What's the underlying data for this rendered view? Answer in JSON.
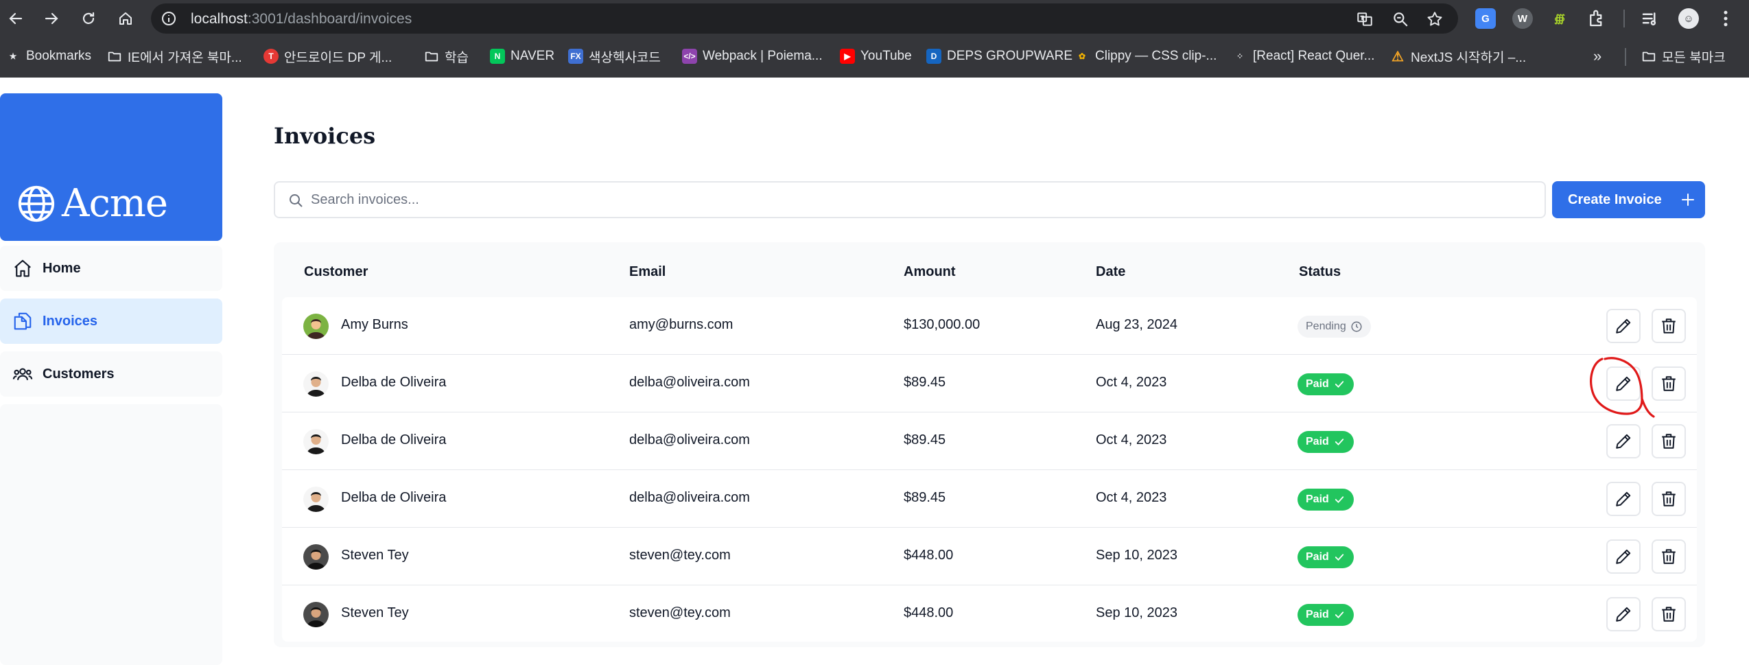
{
  "browser": {
    "url_host": "localhost",
    "url_rest": ":3001/dashboard/invoices",
    "bookmarks": [
      {
        "label": "Bookmarks",
        "icon": "star-icon"
      },
      {
        "label": "IE에서 가져온 북마...",
        "icon": "folder-icon"
      },
      {
        "label": "안드로이드 DP 게...",
        "icon": "site-icon",
        "color": "#e53935"
      },
      {
        "label": "학습",
        "icon": "folder-icon"
      },
      {
        "label": "NAVER",
        "icon": "naver-icon",
        "color": "#03c75a"
      },
      {
        "label": "색상헥사코드",
        "icon": "fx-icon",
        "color": "#3f6fd1"
      },
      {
        "label": "Webpack | Poiema...",
        "icon": "code-icon",
        "color": "#8e44ad"
      },
      {
        "label": "YouTube",
        "icon": "youtube-icon",
        "color": "#ff0000"
      },
      {
        "label": "DEPS GROUPWARE",
        "icon": "deps-icon",
        "color": "#1565c0"
      },
      {
        "label": "Clippy — CSS clip-...",
        "icon": "clippy-icon",
        "color": "#f4b400"
      },
      {
        "label": "[React] React Quer...",
        "icon": "dots-icon",
        "color": "#202124"
      },
      {
        "label": "NextJS 시작하기 –...",
        "icon": "warning-icon",
        "color": "#f9a825"
      }
    ],
    "all_bookmarks": "모든 북마크",
    "more_chevron": "»"
  },
  "app": {
    "logo_text": "Acme",
    "nav": [
      {
        "label": "Home",
        "icon": "home-icon"
      },
      {
        "label": "Invoices",
        "icon": "document-icon"
      },
      {
        "label": "Customers",
        "icon": "users-icon"
      }
    ],
    "page_title": "Invoices",
    "search_placeholder": "Search invoices...",
    "create_button": "Create Invoice",
    "columns": [
      "Customer",
      "Email",
      "Amount",
      "Date",
      "Status"
    ],
    "invoices": [
      {
        "name": "Amy Burns",
        "email": "amy@burns.com",
        "amount": "$130,000.00",
        "date": "Aug 23, 2024",
        "status": "Pending"
      },
      {
        "name": "Delba de Oliveira",
        "email": "delba@oliveira.com",
        "amount": "$89.45",
        "date": "Oct 4, 2023",
        "status": "Paid"
      },
      {
        "name": "Delba de Oliveira",
        "email": "delba@oliveira.com",
        "amount": "$89.45",
        "date": "Oct 4, 2023",
        "status": "Paid"
      },
      {
        "name": "Delba de Oliveira",
        "email": "delba@oliveira.com",
        "amount": "$89.45",
        "date": "Oct 4, 2023",
        "status": "Paid"
      },
      {
        "name": "Steven Tey",
        "email": "steven@tey.com",
        "amount": "$448.00",
        "date": "Sep 10, 2023",
        "status": "Paid"
      },
      {
        "name": "Steven Tey",
        "email": "steven@tey.com",
        "amount": "$448.00",
        "date": "Sep 10, 2023",
        "status": "Paid"
      }
    ]
  },
  "colors": {
    "brand_blue": "#2f6fe8",
    "paid_green": "#22c55e",
    "annotation_red": "#e01919"
  }
}
